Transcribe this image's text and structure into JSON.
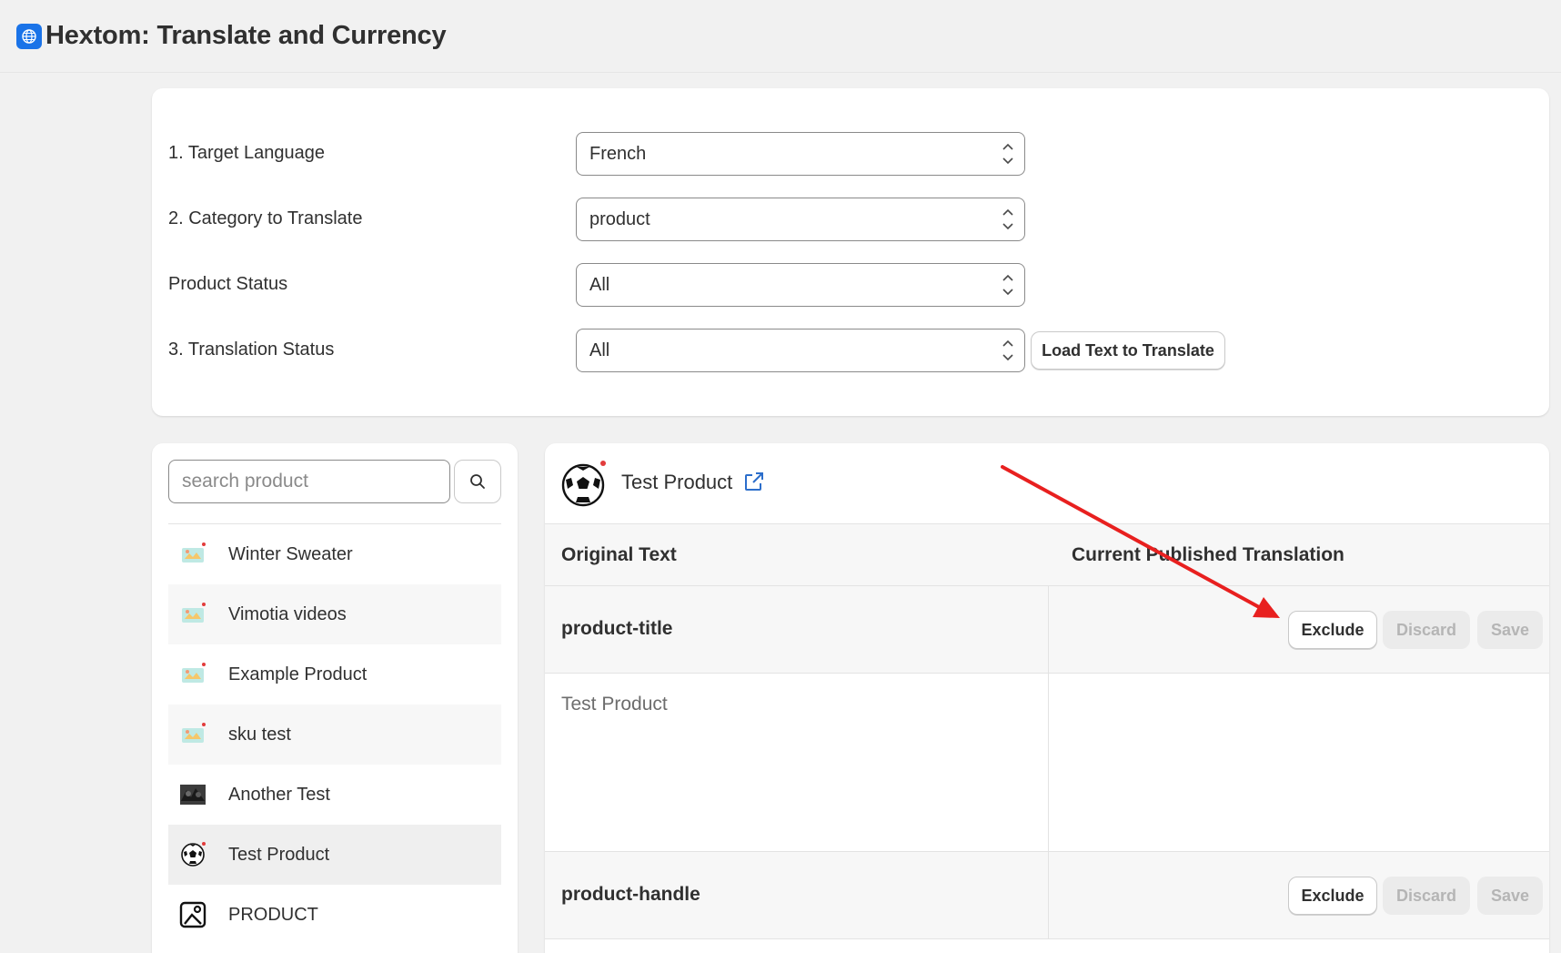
{
  "app": {
    "title": "Hextom: Translate and Currency",
    "logo_icon": "globe-icon",
    "accent_color": "#1a73e8"
  },
  "settings": {
    "target_language": {
      "label": "1. Target Language",
      "value": "French"
    },
    "category": {
      "label": "2. Category to Translate",
      "value": "product"
    },
    "product_status": {
      "label": "Product Status",
      "value": "All"
    },
    "translation_status": {
      "label": "3. Translation Status",
      "value": "All"
    },
    "load_button_label": "Load Text to Translate"
  },
  "sidebar": {
    "search_placeholder": "search product",
    "search_icon": "search-icon",
    "products": [
      {
        "name": "Winter Sweater",
        "thumb": "placeholder-image-icon"
      },
      {
        "name": "Vimotia videos",
        "thumb": "placeholder-image-icon"
      },
      {
        "name": "Example Product",
        "thumb": "placeholder-image-icon"
      },
      {
        "name": "sku test",
        "thumb": "placeholder-image-icon"
      },
      {
        "name": "Another Test",
        "thumb": "dark-photo-icon"
      },
      {
        "name": "Test Product",
        "thumb": "soccer-ball-icon"
      },
      {
        "name": "PRODUCT",
        "thumb": "image-icon"
      }
    ],
    "selected_index": 5
  },
  "main": {
    "product_title": "Test Product",
    "product_icon": "soccer-ball-icon",
    "link_icon": "external-link-icon",
    "columns": [
      "Original Text",
      "Current Published Translation"
    ],
    "rows": [
      {
        "key": "product-title",
        "original": "Test Product",
        "translation": "",
        "buttons": {
          "exclude": "Exclude",
          "discard": "Discard",
          "save": "Save"
        }
      },
      {
        "key": "product-handle",
        "original": "",
        "translation": "",
        "buttons": {
          "exclude": "Exclude",
          "discard": "Discard",
          "save": "Save"
        }
      }
    ]
  },
  "annotation": {
    "arrow_color": "#e8201f"
  }
}
